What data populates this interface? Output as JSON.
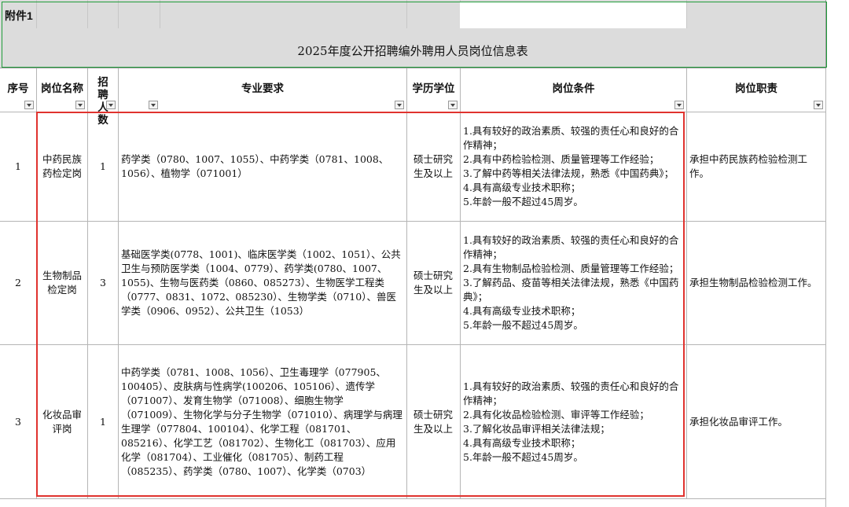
{
  "sheet": {
    "attachment_label": "附件1",
    "title": "2025年度公开招聘编外聘用人员岗位信息表"
  },
  "headers": {
    "seq": "序号",
    "post": "岗位名称",
    "count": "招聘人数",
    "major": "专业要求",
    "degree": "学历学位",
    "conditions": "岗位条件",
    "duties": "岗位职责"
  },
  "rows": [
    {
      "seq": "1",
      "post": "中药民族药检定岗",
      "count": "1",
      "major": "药学类（0780、1007、1055）、中药学类（0781、1008、1056）、植物学（071001）",
      "degree": "硕士研究生及以上",
      "conditions": [
        "1.具有较好的政治素质、较强的责任心和良好的合作精神；",
        "2.具有中药检验检测、质量管理等工作经验；",
        "3.了解中药等相关法律法规，熟悉《中国药典》；",
        "4.具有高级专业技术职称；",
        "5.年龄一般不超过45周岁。"
      ],
      "duties": "承担中药民族药检验检测工作。"
    },
    {
      "seq": "2",
      "post": "生物制品检定岗",
      "count": "3",
      "major": "基础医学类(0778、1001)、临床医学类（1002、1051）、公共卫生与预防医学类（1004、0779）、药学类(0780、1007、1055)、生物与医药类（0860、085273）、生物医学工程类（0777、0831、1072、085230）、生物学类（0710）、兽医学类（0906、0952）、公共卫生（1053）",
      "degree": "硕士研究生及以上",
      "conditions": [
        "1.具有较好的政治素质、较强的责任心和良好的合作精神；",
        "2.具有生物制品检验检测、质量管理等工作经验；",
        "3.了解药品、疫苗等相关法律法规，熟悉《中国药典》；",
        "4.具有高级专业技术职称；",
        "5.年龄一般不超过45周岁。"
      ],
      "duties": "承担生物制品检验检测工作。"
    },
    {
      "seq": "3",
      "post": "化妆品审评岗",
      "count": "1",
      "major": "中药学类（0781、1008、1056）、卫生毒理学（077905、100405）、皮肤病与性病学(100206、105106）、遗传学（071007）、发育生物学（071008）、细胞生物学（071009）、生物化学与分子生物学（071010）、病理学与病理生理学（077804、100104）、化学工程（081701、085216）、化学工艺（081702）、生物化工（081703）、应用化学（081704）、工业催化（081705）、制药工程（085235）、药学类（0780、1007）、化学类（0703）",
      "degree": "硕士研究生及以上",
      "conditions": [
        "1.具有较好的政治素质、较强的责任心和良好的合作精神；",
        "2.具有化妆品检验检测、审评等工作经验；",
        "3.了解化妆品审评相关法律法规；",
        "4.具有高级专业技术职称；",
        "5.年龄一般不超过45周岁。"
      ],
      "duties": "承担化妆品审评工作。"
    }
  ],
  "colors": {
    "highlight_box": "#e0332f",
    "header_band": "#dcdcdc",
    "selection_border": "#1f9c3a"
  }
}
